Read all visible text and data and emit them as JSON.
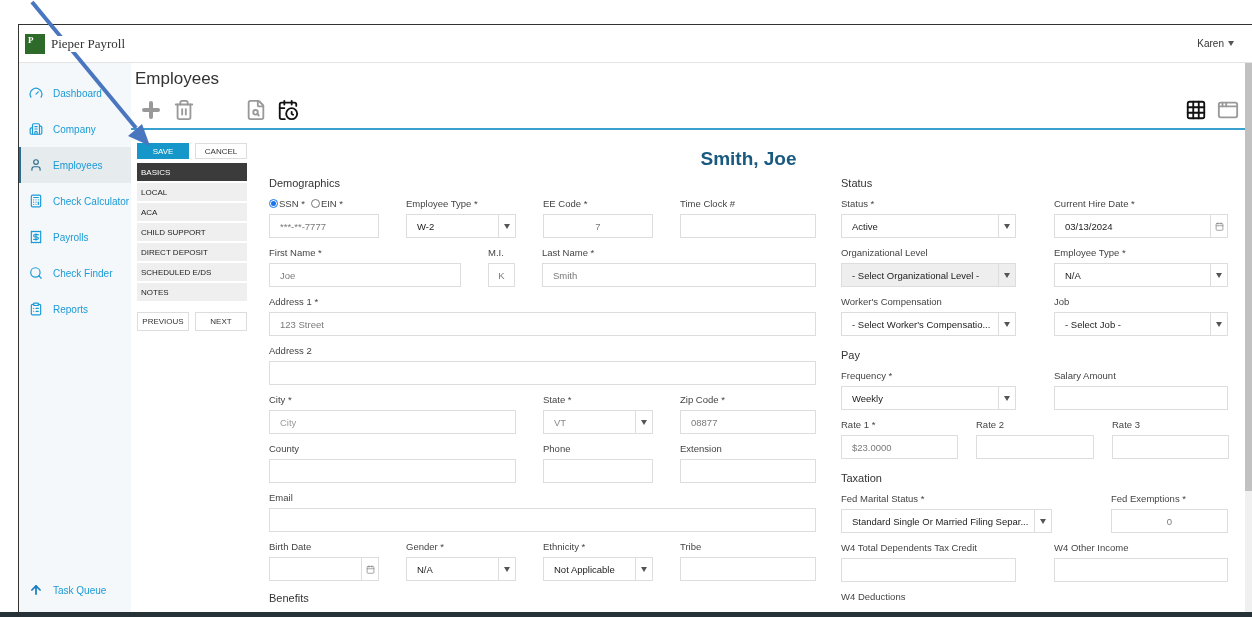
{
  "header": {
    "logo": "P",
    "brand": "Pieper Payroll",
    "user": "Karen"
  },
  "nav": {
    "items": [
      {
        "label": "Dashboard",
        "selected": false
      },
      {
        "label": "Company",
        "selected": false
      },
      {
        "label": "Employees",
        "selected": true
      },
      {
        "label": "Check Calculator",
        "selected": false
      },
      {
        "label": "Payrolls",
        "selected": false
      },
      {
        "label": "Check Finder",
        "selected": false
      },
      {
        "label": "Reports",
        "selected": false
      }
    ],
    "task_queue": "Task Queue"
  },
  "page": {
    "title": "Employees"
  },
  "actions": {
    "save": "SAVE",
    "cancel": "CANCEL"
  },
  "sections": [
    {
      "label": "BASICS",
      "selected": true
    },
    {
      "label": "LOCAL",
      "selected": false
    },
    {
      "label": "ACA",
      "selected": false
    },
    {
      "label": "CHILD SUPPORT",
      "selected": false
    },
    {
      "label": "DIRECT DEPOSIT",
      "selected": false
    },
    {
      "label": "SCHEDULED E/DS",
      "selected": false
    },
    {
      "label": "NOTES",
      "selected": false
    }
  ],
  "pager": {
    "previous": "PREVIOUS",
    "next": "NEXT"
  },
  "employee_name": "Smith, Joe",
  "demographics": {
    "heading": "Demographics",
    "rows": [
      [
        {
          "kind": "id",
          "options": [
            {
              "label": "SSN *",
              "selected": true
            },
            {
              "label": "EIN *",
              "selected": false
            }
          ],
          "value": "***-**-7777"
        },
        {
          "kind": "select",
          "label": "Employee Type *",
          "value": "W-2"
        },
        {
          "kind": "text",
          "label": "EE Code *",
          "value": "7",
          "centered": true
        },
        {
          "kind": "text",
          "label": "Time Clock #"
        }
      ],
      [
        {
          "kind": "text",
          "label": "First Name *",
          "value": "Joe"
        },
        {
          "kind": "text",
          "label": "M.I.",
          "value": "K",
          "centered": true
        },
        {
          "kind": "text",
          "label": "Last Name *",
          "value": "Smith"
        }
      ],
      [
        {
          "kind": "text",
          "label": "Address 1 *",
          "value": "123 Street"
        }
      ],
      [
        {
          "kind": "text",
          "label": "Address 2"
        }
      ],
      [
        {
          "kind": "text",
          "label": "City *",
          "placeholder": "City"
        },
        {
          "kind": "select",
          "label": "State *",
          "value": "VT",
          "muted": true
        },
        {
          "kind": "text",
          "label": "Zip Code *",
          "value": "08877"
        }
      ],
      [
        {
          "kind": "text",
          "label": "County"
        },
        {
          "kind": "text",
          "label": "Phone"
        },
        {
          "kind": "text",
          "label": "Extension"
        }
      ],
      [
        {
          "kind": "text",
          "label": "Email"
        }
      ],
      [
        {
          "kind": "date",
          "label": "Birth Date"
        },
        {
          "kind": "select",
          "label": "Gender *",
          "value": "N/A"
        },
        {
          "kind": "select",
          "label": "Ethnicity *",
          "value": "Not Applicable"
        },
        {
          "kind": "text",
          "label": "Tribe"
        }
      ]
    ]
  },
  "benefits": {
    "heading": "Benefits"
  },
  "groups": [
    {
      "heading": "Status",
      "rows": [
        [
          {
            "kind": "select",
            "label": "Status *",
            "value": "Active"
          },
          {
            "kind": "date",
            "label": "Current Hire Date *",
            "value": "03/13/2024"
          }
        ],
        [
          {
            "kind": "select",
            "label": "Organizational Level",
            "value": "- Select Organizational Level -",
            "disabled": true
          },
          {
            "kind": "select",
            "label": "Employee Type *",
            "value": "N/A"
          }
        ],
        [
          {
            "kind": "select",
            "label": "Worker's Compensation",
            "value": "- Select Worker's Compensatio..."
          },
          {
            "kind": "select",
            "label": "Job",
            "value": "- Select Job -"
          }
        ]
      ]
    },
    {
      "heading": "Pay",
      "rows": [
        [
          {
            "kind": "select",
            "label": "Frequency *",
            "value": "Weekly"
          },
          {
            "kind": "text",
            "label": "Salary Amount"
          }
        ],
        [
          {
            "kind": "text",
            "label": "Rate 1 *",
            "value": "$23.0000"
          },
          {
            "kind": "text",
            "label": "Rate 2"
          },
          {
            "kind": "text",
            "label": "Rate 3"
          }
        ]
      ]
    },
    {
      "heading": "Taxation",
      "rows": [
        [
          {
            "kind": "select",
            "label": "Fed Marital Status *",
            "value": "Standard Single Or Married Filing Separ..."
          },
          {
            "kind": "text",
            "label": "Fed Exemptions *",
            "value": "0",
            "centered": true
          }
        ],
        [
          {
            "kind": "text",
            "label": "W4 Total Dependents Tax Credit"
          },
          {
            "kind": "text",
            "label": "W4 Other Income"
          }
        ],
        [
          {
            "kind": "label",
            "label": "W4 Deductions"
          }
        ]
      ]
    }
  ]
}
